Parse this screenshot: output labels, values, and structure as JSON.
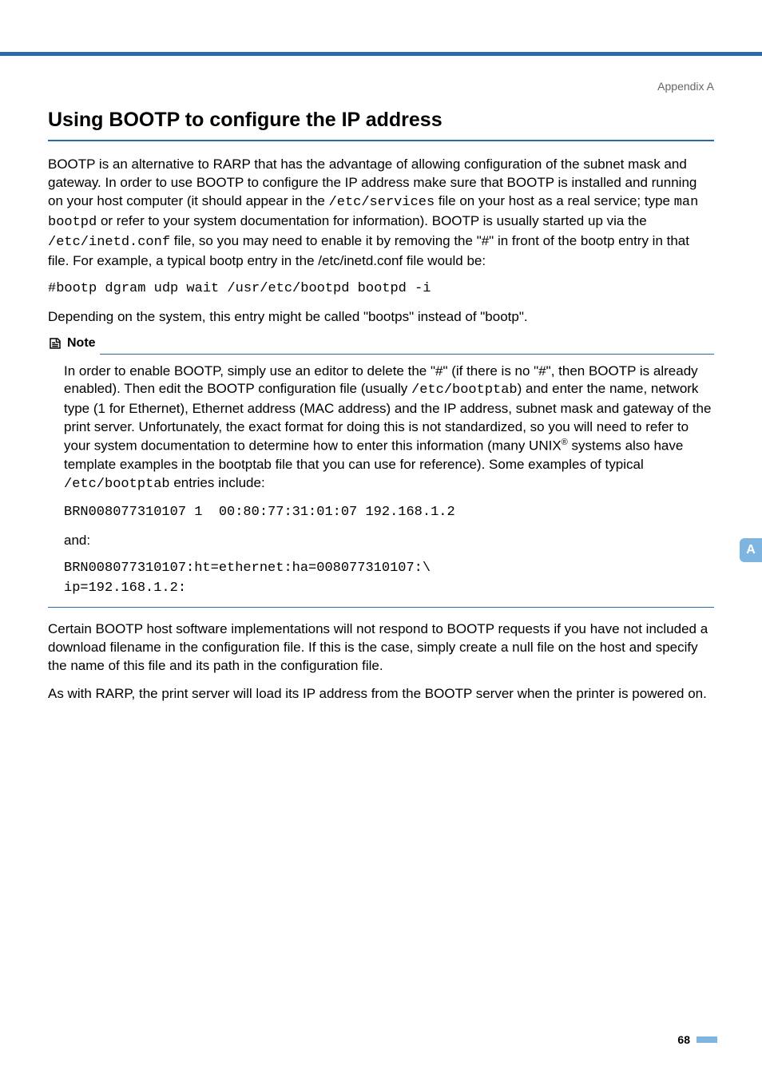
{
  "crumb": "Appendix A",
  "heading": "Using BOOTP to configure the IP address",
  "para1_pre": "BOOTP is an alternative to RARP that has the advantage of allowing configuration of the subnet mask and gateway. In order to use BOOTP to configure the IP address make sure that BOOTP is installed and running on your host computer (it should appear in the ",
  "para1_code1": "/etc/services",
  "para1_mid1": " file on your host as a real service; type ",
  "para1_code2": "man bootpd",
  "para1_mid2": " or refer to your system documentation for information). BOOTP is usually started up via the ",
  "para1_code3": "/etc/inetd.conf",
  "para1_post": " file, so you may need to enable it by removing the \"#\" in front of the bootp entry in that file. For example, a typical bootp entry in the /etc/inetd.conf file would be:",
  "code1": "#bootp dgram udp wait /usr/etc/bootpd bootpd -i",
  "para2": "Depending on the system, this entry might be called \"bootps\" instead of \"bootp\".",
  "note_label": "Note",
  "note_p1_pre": "In order to enable BOOTP, simply use an editor to delete the \"#\" (if there is no \"#\", then BOOTP is already enabled). Then edit the BOOTP configuration file (usually ",
  "note_p1_code": "/etc/bootptab",
  "note_p1_post": ") and enter the name, network type (1 for Ethernet), Ethernet address (MAC address) and the IP address, subnet mask and gateway of the print server. Unfortunately, the exact format for doing this is not standardized, so you will need to refer to your system documentation to determine how to enter this information (many UNIX",
  "note_p1_sup": "®",
  "note_p1_end_pre": " systems also have template examples in the bootptab file that you can use for reference). Some examples of typical ",
  "note_p1_end_code": "/etc/bootptab",
  "note_p1_end_post": " entries include:",
  "note_code1": "BRN008077310107 1  00:80:77:31:01:07 192.168.1.2",
  "note_and": "and:",
  "note_code2": "BRN008077310107:ht=ethernet:ha=008077310107:\\",
  "note_code3": "ip=192.168.1.2:",
  "para3": "Certain BOOTP host software implementations will not respond to BOOTP requests if you have not included a download filename in the configuration file. If this is the case, simply create a null file on the host and specify the name of this file and its path in the configuration file.",
  "para4": "As with RARP, the print server will load its IP address from the BOOTP server when the printer is powered on.",
  "sidetab": "A",
  "pagenum": "68"
}
